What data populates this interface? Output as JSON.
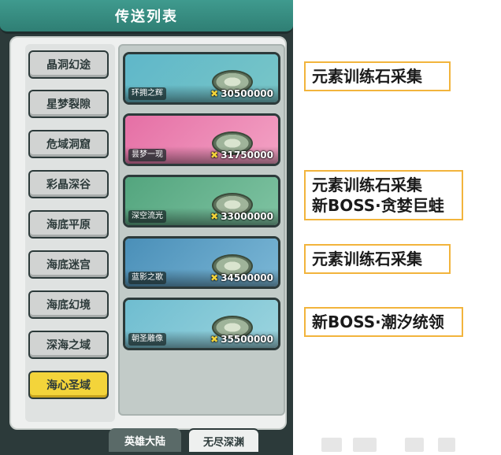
{
  "header": {
    "title": "传送列表"
  },
  "nav": {
    "items": [
      {
        "label": "晶洞幻途"
      },
      {
        "label": "星梦裂隙"
      },
      {
        "label": "危域洞窟"
      },
      {
        "label": "彩晶深谷"
      },
      {
        "label": "海底平原"
      },
      {
        "label": "海底迷宫"
      },
      {
        "label": "海底幻境"
      },
      {
        "label": "深海之域"
      },
      {
        "label": "海心圣域"
      }
    ],
    "active_index": 8
  },
  "destinations": [
    {
      "name": "环拥之辉",
      "price": "30500000",
      "scene_colors": [
        "#5fb7c9",
        "#78c6c8"
      ]
    },
    {
      "name": "昙梦一现",
      "price": "31750000",
      "scene_colors": [
        "#e56fa5",
        "#f3a2c4"
      ]
    },
    {
      "name": "深空流光",
      "price": "33000000",
      "scene_colors": [
        "#53a57e",
        "#7fc3a2"
      ]
    },
    {
      "name": "蓝影之歌",
      "price": "34500000",
      "scene_colors": [
        "#4a8fb8",
        "#7bb7d6"
      ]
    },
    {
      "name": "朝圣雕像",
      "price": "35500000",
      "scene_colors": [
        "#6fbdd0",
        "#9bd4de"
      ]
    }
  ],
  "tabs": [
    {
      "label": "英雄大陆"
    },
    {
      "label": "无尽深渊"
    }
  ],
  "annotations": [
    {
      "lines": [
        "元素训练石采集"
      ]
    },
    {
      "lines": [
        "元素训练石采集",
        "新BOSS·贪婪巨蛙"
      ]
    },
    {
      "lines": [
        "元素训练石采集"
      ]
    },
    {
      "lines": [
        "新BOSS·潮汐统领"
      ]
    }
  ],
  "colors": {
    "title_bar": "#3f9a8e",
    "active_nav": "#f3d43a",
    "annotation_border": "#f2b43c",
    "price_coin": "#f3d43a"
  },
  "icons": {
    "price": "coin-icon"
  }
}
